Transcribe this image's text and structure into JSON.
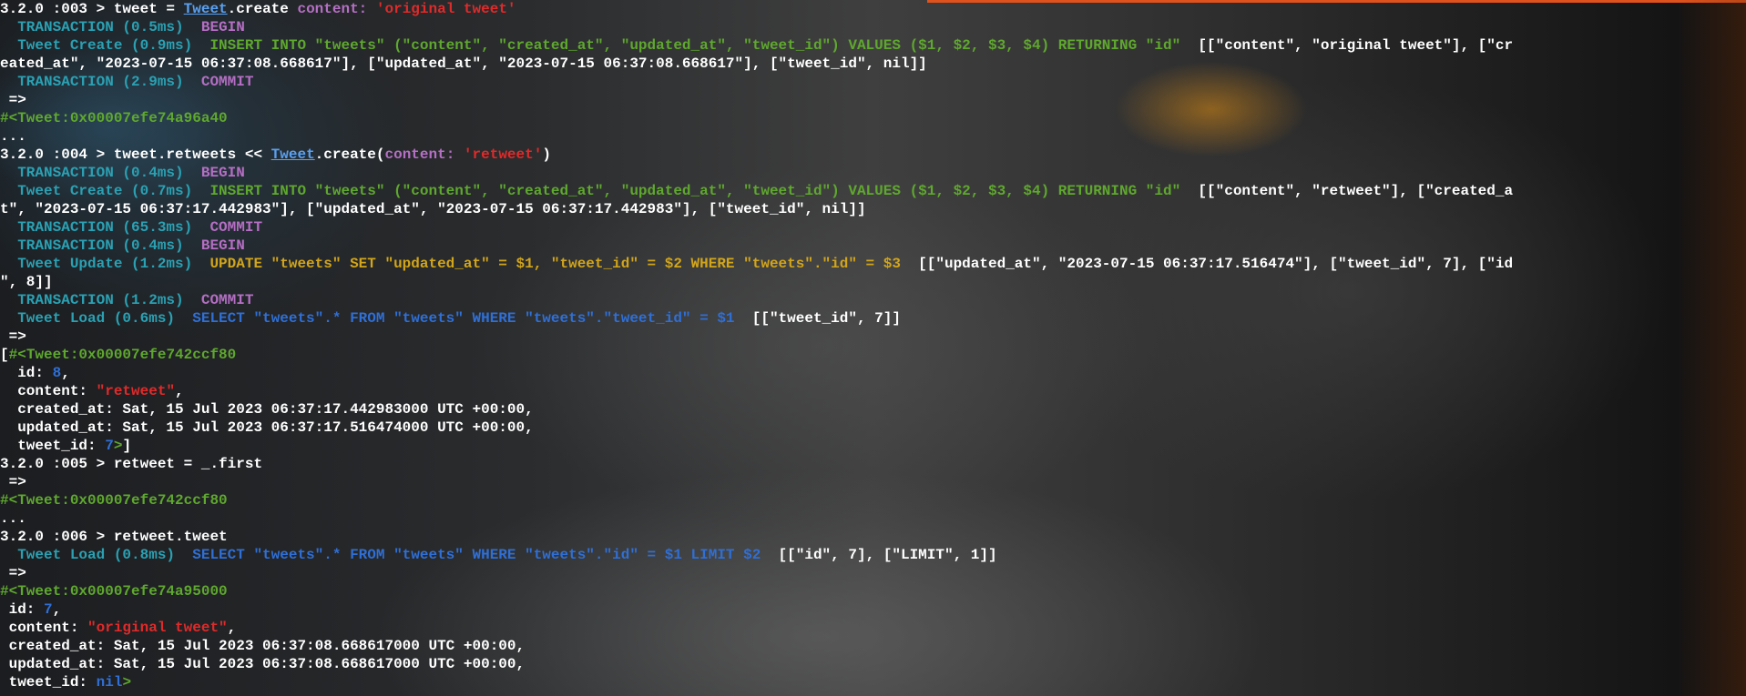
{
  "colors": {
    "cyan": "#2aa1b3",
    "purple": "#b56fc4",
    "green": "#5fa82e",
    "yellow": "#d2a51a",
    "blue": "#2f6fd6",
    "red": "#e02a2a",
    "white": "#ffffff",
    "link": "#5aa0f0",
    "accent_bar": "#e0521d"
  },
  "lines": [
    [
      [
        "prompt",
        "3.2.0 :003 > tweet = "
      ],
      [
        "link",
        "Tweet"
      ],
      [
        "white",
        ".create "
      ],
      [
        "purple",
        "content: "
      ],
      [
        "red",
        "'original tweet'"
      ]
    ],
    [
      [
        "cyan",
        "  TRANSACTION (0.5ms)  "
      ],
      [
        "purple",
        "BEGIN"
      ]
    ],
    [
      [
        "cyan",
        "  Tweet Create (0.9ms)  "
      ],
      [
        "green",
        "INSERT INTO \"tweets\" (\"content\", \"created_at\", \"updated_at\", \"tweet_id\") VALUES ($1, $2, $3, $4) RETURNING \"id\""
      ],
      [
        "white",
        "  [[\"content\", \"original tweet\"], [\"cr"
      ]
    ],
    [
      [
        "white",
        "eated_at\", \"2023-07-15 06:37:08.668617\"], [\"updated_at\", \"2023-07-15 06:37:08.668617\"], [\"tweet_id\", nil]]"
      ]
    ],
    [
      [
        "cyan",
        "  TRANSACTION (2.9ms)  "
      ],
      [
        "purple",
        "COMMIT"
      ]
    ],
    [
      [
        "white",
        " =>"
      ]
    ],
    [
      [
        "green",
        "#<Tweet:0x00007efe74a96a40"
      ]
    ],
    [
      [
        "white",
        "..."
      ]
    ],
    [
      [
        "prompt",
        "3.2.0 :004 > tweet.retweets << "
      ],
      [
        "link",
        "Tweet"
      ],
      [
        "white",
        ".create("
      ],
      [
        "purple",
        "content: "
      ],
      [
        "red",
        "'retweet'"
      ],
      [
        "white",
        ")"
      ]
    ],
    [
      [
        "cyan",
        "  TRANSACTION (0.4ms)  "
      ],
      [
        "purple",
        "BEGIN"
      ]
    ],
    [
      [
        "cyan",
        "  Tweet Create (0.7ms)  "
      ],
      [
        "green",
        "INSERT INTO \"tweets\" (\"content\", \"created_at\", \"updated_at\", \"tweet_id\") VALUES ($1, $2, $3, $4) RETURNING \"id\""
      ],
      [
        "white",
        "  [[\"content\", \"retweet\"], [\"created_a"
      ]
    ],
    [
      [
        "white",
        "t\", \"2023-07-15 06:37:17.442983\"], [\"updated_at\", \"2023-07-15 06:37:17.442983\"], [\"tweet_id\", nil]]"
      ]
    ],
    [
      [
        "cyan",
        "  TRANSACTION (65.3ms)  "
      ],
      [
        "purple",
        "COMMIT"
      ]
    ],
    [
      [
        "cyan",
        "  TRANSACTION (0.4ms)  "
      ],
      [
        "purple",
        "BEGIN"
      ]
    ],
    [
      [
        "cyan",
        "  Tweet Update (1.2ms)  "
      ],
      [
        "yellow",
        "UPDATE \"tweets\" SET \"updated_at\" = $1, \"tweet_id\" = $2 WHERE \"tweets\".\"id\" = $3"
      ],
      [
        "white",
        "  [[\"updated_at\", \"2023-07-15 06:37:17.516474\"], [\"tweet_id\", 7], [\"id"
      ]
    ],
    [
      [
        "white",
        "\", 8]]"
      ]
    ],
    [
      [
        "cyan",
        "  TRANSACTION (1.2ms)  "
      ],
      [
        "purple",
        "COMMIT"
      ]
    ],
    [
      [
        "cyan",
        "  Tweet Load (0.6ms)  "
      ],
      [
        "blue",
        "SELECT \"tweets\".* FROM \"tweets\" WHERE \"tweets\".\"tweet_id\" = $1"
      ],
      [
        "white",
        "  [[\"tweet_id\", 7]]"
      ]
    ],
    [
      [
        "white",
        " =>"
      ]
    ],
    [
      [
        "white",
        "["
      ],
      [
        "green",
        "#<Tweet:0x00007efe742ccf80"
      ]
    ],
    [
      [
        "white",
        "  id: "
      ],
      [
        "blue",
        "8"
      ],
      [
        "white",
        ","
      ]
    ],
    [
      [
        "white",
        "  content: "
      ],
      [
        "red",
        "\"retweet\""
      ],
      [
        "white",
        ","
      ]
    ],
    [
      [
        "white",
        "  created_at: Sat, 15 Jul 2023 06:37:17.442983000 UTC +00:00,"
      ]
    ],
    [
      [
        "white",
        "  updated_at: Sat, 15 Jul 2023 06:37:17.516474000 UTC +00:00,"
      ]
    ],
    [
      [
        "white",
        "  tweet_id: "
      ],
      [
        "blue",
        "7"
      ],
      [
        "green",
        ">"
      ],
      [
        "white",
        "]"
      ]
    ],
    [
      [
        "prompt",
        "3.2.0 :005 > retweet = _.first"
      ]
    ],
    [
      [
        "white",
        " =>"
      ]
    ],
    [
      [
        "green",
        "#<Tweet:0x00007efe742ccf80"
      ]
    ],
    [
      [
        "white",
        "..."
      ]
    ],
    [
      [
        "prompt",
        "3.2.0 :006 > retweet.tweet"
      ]
    ],
    [
      [
        "cyan",
        "  Tweet Load (0.8ms)  "
      ],
      [
        "blue",
        "SELECT \"tweets\".* FROM \"tweets\" WHERE \"tweets\".\"id\" = $1 LIMIT $2"
      ],
      [
        "white",
        "  [[\"id\", 7], [\"LIMIT\", 1]]"
      ]
    ],
    [
      [
        "white",
        " =>"
      ]
    ],
    [
      [
        "green",
        "#<Tweet:0x00007efe74a95000"
      ]
    ],
    [
      [
        "white",
        " id: "
      ],
      [
        "blue",
        "7"
      ],
      [
        "white",
        ","
      ]
    ],
    [
      [
        "white",
        " content: "
      ],
      [
        "red",
        "\"original tweet\""
      ],
      [
        "white",
        ","
      ]
    ],
    [
      [
        "white",
        " created_at: Sat, 15 Jul 2023 06:37:08.668617000 UTC +00:00,"
      ]
    ],
    [
      [
        "white",
        " updated_at: Sat, 15 Jul 2023 06:37:08.668617000 UTC +00:00,"
      ]
    ],
    [
      [
        "white",
        " tweet_id: "
      ],
      [
        "blue",
        "nil"
      ],
      [
        "green",
        ">"
      ]
    ]
  ]
}
